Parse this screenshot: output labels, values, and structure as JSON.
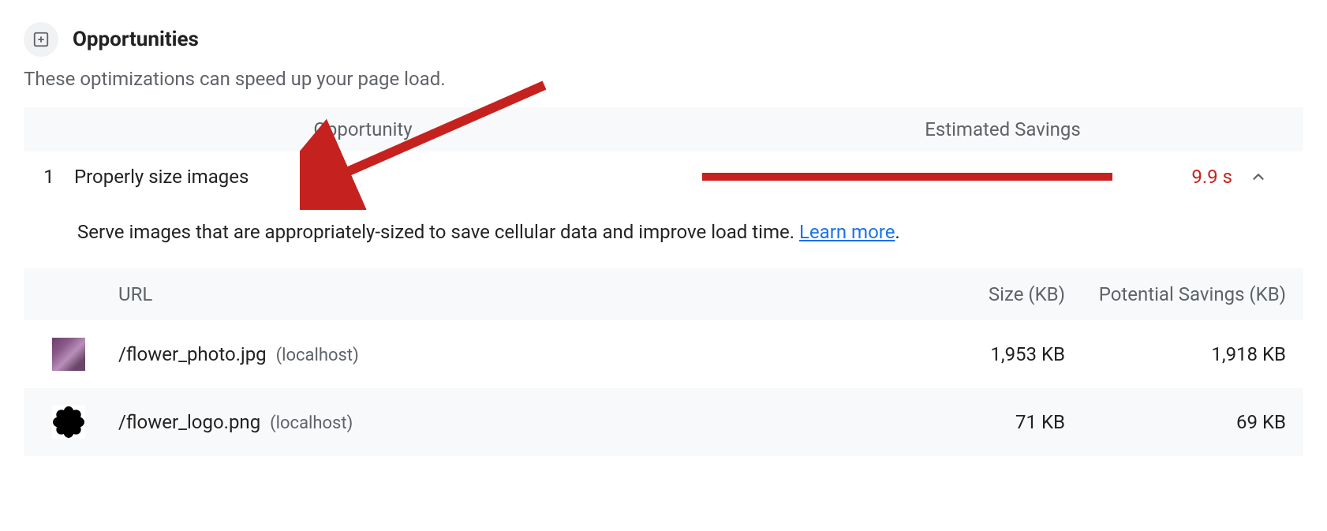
{
  "section": {
    "title": "Opportunities",
    "subtitle": "These optimizations can speed up your page load."
  },
  "columns": {
    "opportunity": "Opportunity",
    "savings": "Estimated Savings"
  },
  "opportunity": {
    "index": "1",
    "title": "Properly size images",
    "savings_value": "9.9 s",
    "description_pre": "Serve images that are appropriately-sized to save cellular data and improve load time. ",
    "learn_more": "Learn more",
    "description_post": "."
  },
  "table": {
    "headers": {
      "url": "URL",
      "size": "Size (KB)",
      "savings": "Potential Savings (KB)"
    },
    "rows": [
      {
        "thumb_kind": "photo",
        "path": "/flower_photo.jpg",
        "host": "(localhost)",
        "size": "1,953 KB",
        "savings": "1,918 KB"
      },
      {
        "thumb_kind": "logo",
        "path": "/flower_logo.png",
        "host": "(localhost)",
        "size": "71 KB",
        "savings": "69 KB"
      }
    ]
  }
}
